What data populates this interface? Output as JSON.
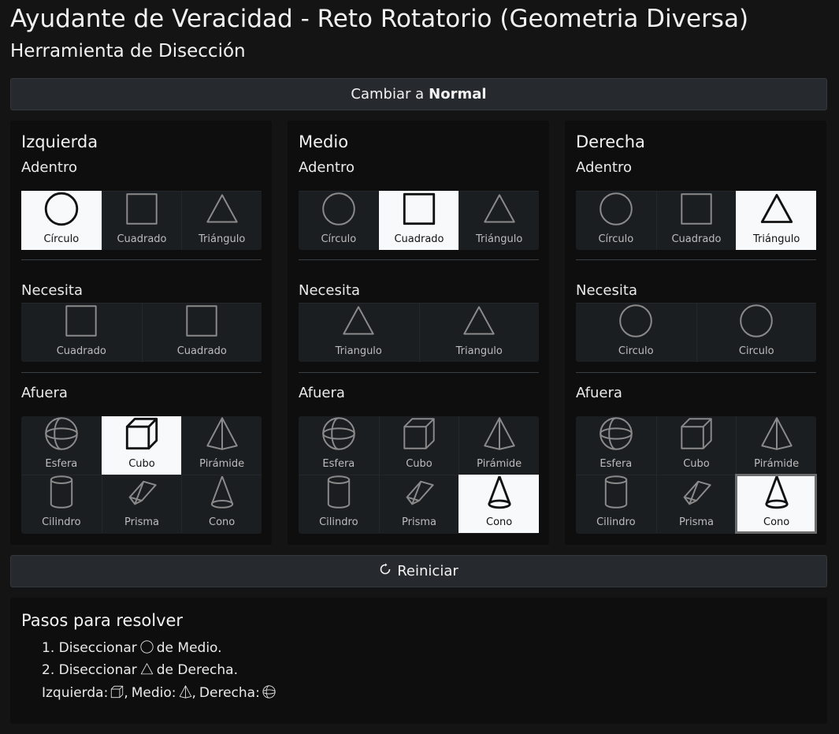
{
  "header": {
    "title": "Ayudante de Veracidad - Reto Rotatorio (Geometria Diversa)",
    "subtitle": "Herramienta de Disección"
  },
  "mode_toggle": {
    "prefix": "Cambiar a",
    "mode": "Normal"
  },
  "reset_button": {
    "label": "Reiniciar",
    "icon": "refresh-icon"
  },
  "section_labels": {
    "inside": "Adentro",
    "needs": "Necesita",
    "outside": "Afuera"
  },
  "columns": [
    {
      "title": "Izquierda",
      "inside": [
        {
          "label": "Círculo",
          "icon": "circle",
          "selected": true
        },
        {
          "label": "Cuadrado",
          "icon": "square",
          "selected": false
        },
        {
          "label": "Triángulo",
          "icon": "triangle",
          "selected": false
        }
      ],
      "needs": [
        {
          "label": "Cuadrado",
          "icon": "square"
        },
        {
          "label": "Cuadrado",
          "icon": "square"
        }
      ],
      "outside": [
        {
          "label": "Esfera",
          "icon": "sphere",
          "selected": false
        },
        {
          "label": "Cubo",
          "icon": "cube",
          "selected": true
        },
        {
          "label": "Pirámide",
          "icon": "pyramid",
          "selected": false
        },
        {
          "label": "Cilindro",
          "icon": "cylinder",
          "selected": false
        },
        {
          "label": "Prisma",
          "icon": "prism",
          "selected": false
        },
        {
          "label": "Cono",
          "icon": "cone",
          "selected": false
        }
      ]
    },
    {
      "title": "Medio",
      "inside": [
        {
          "label": "Círculo",
          "icon": "circle",
          "selected": false
        },
        {
          "label": "Cuadrado",
          "icon": "square",
          "selected": true
        },
        {
          "label": "Triángulo",
          "icon": "triangle",
          "selected": false
        }
      ],
      "needs": [
        {
          "label": "Triangulo",
          "icon": "triangle"
        },
        {
          "label": "Triangulo",
          "icon": "triangle"
        }
      ],
      "outside": [
        {
          "label": "Esfera",
          "icon": "sphere",
          "selected": false
        },
        {
          "label": "Cubo",
          "icon": "cube",
          "selected": false
        },
        {
          "label": "Pirámide",
          "icon": "pyramid",
          "selected": false
        },
        {
          "label": "Cilindro",
          "icon": "cylinder",
          "selected": false
        },
        {
          "label": "Prisma",
          "icon": "prism",
          "selected": false
        },
        {
          "label": "Cono",
          "icon": "cone",
          "selected": true
        }
      ]
    },
    {
      "title": "Derecha",
      "inside": [
        {
          "label": "Círculo",
          "icon": "circle",
          "selected": false
        },
        {
          "label": "Cuadrado",
          "icon": "square",
          "selected": false
        },
        {
          "label": "Triángulo",
          "icon": "triangle",
          "selected": true
        }
      ],
      "needs": [
        {
          "label": "Circulo",
          "icon": "circle"
        },
        {
          "label": "Circulo",
          "icon": "circle"
        }
      ],
      "outside": [
        {
          "label": "Esfera",
          "icon": "sphere",
          "selected": false
        },
        {
          "label": "Cubo",
          "icon": "cube",
          "selected": false
        },
        {
          "label": "Pirámide",
          "icon": "pyramid",
          "selected": false
        },
        {
          "label": "Cilindro",
          "icon": "cylinder",
          "selected": false
        },
        {
          "label": "Prisma",
          "icon": "prism",
          "selected": false
        },
        {
          "label": "Cono",
          "icon": "cone",
          "selected": true,
          "focused": true
        }
      ]
    }
  ],
  "steps": {
    "title": "Pasos para resolver",
    "items": [
      {
        "prefix": "1. Diseccionar",
        "icon": "circle",
        "suffix": "de Medio."
      },
      {
        "prefix": "2. Diseccionar",
        "icon": "triangle",
        "suffix": "de Derecha."
      }
    ],
    "summary": [
      {
        "label": "Izquierda:",
        "icon": "cube",
        "sep": ","
      },
      {
        "label": "Medio:",
        "icon": "pyramid",
        "sep": ","
      },
      {
        "label": "Derecha:",
        "icon": "sphere",
        "sep": ""
      }
    ]
  }
}
